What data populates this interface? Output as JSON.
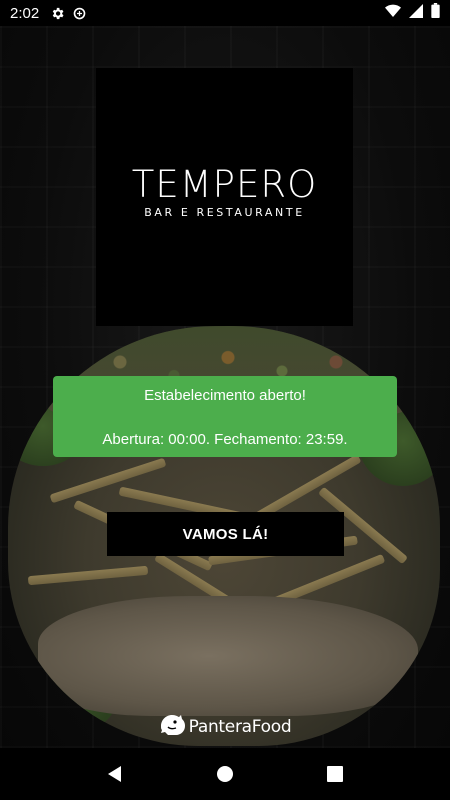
{
  "status_bar": {
    "time": "2:02",
    "left_icons": [
      "settings-icon",
      "data-saver-icon"
    ],
    "right_icons": [
      "wifi-icon",
      "signal-icon",
      "battery-icon"
    ]
  },
  "logo": {
    "title": "TEMPERO",
    "subtitle": "BAR E RESTAURANTE"
  },
  "status_card": {
    "title": "Estabelecimento aberto!",
    "hours": "Abertura: 00:00. Fechamento: 23:59.",
    "color": "#4cae4c"
  },
  "action_button": {
    "label": "VAMOS LÁ!"
  },
  "brand": {
    "name": "PanteraFood",
    "icon": "panther-icon"
  },
  "nav_bar": {
    "buttons": [
      "back-icon",
      "home-icon",
      "recents-icon"
    ]
  }
}
